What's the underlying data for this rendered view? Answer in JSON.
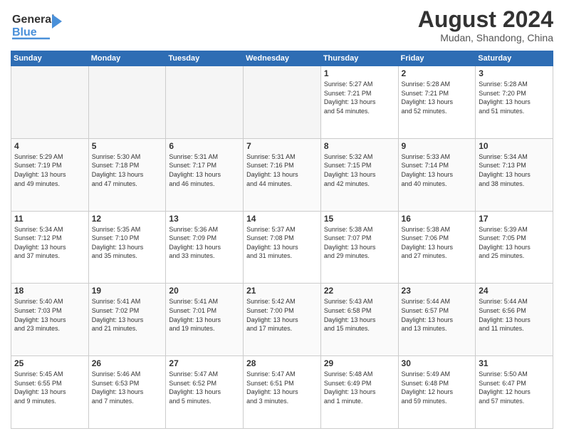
{
  "logo": {
    "line1": "General",
    "line2": "Blue"
  },
  "title": "August 2024",
  "subtitle": "Mudan, Shandong, China",
  "weekdays": [
    "Sunday",
    "Monday",
    "Tuesday",
    "Wednesday",
    "Thursday",
    "Friday",
    "Saturday"
  ],
  "weeks": [
    [
      {
        "day": "",
        "info": ""
      },
      {
        "day": "",
        "info": ""
      },
      {
        "day": "",
        "info": ""
      },
      {
        "day": "",
        "info": ""
      },
      {
        "day": "1",
        "info": "Sunrise: 5:27 AM\nSunset: 7:21 PM\nDaylight: 13 hours\nand 54 minutes."
      },
      {
        "day": "2",
        "info": "Sunrise: 5:28 AM\nSunset: 7:21 PM\nDaylight: 13 hours\nand 52 minutes."
      },
      {
        "day": "3",
        "info": "Sunrise: 5:28 AM\nSunset: 7:20 PM\nDaylight: 13 hours\nand 51 minutes."
      }
    ],
    [
      {
        "day": "4",
        "info": "Sunrise: 5:29 AM\nSunset: 7:19 PM\nDaylight: 13 hours\nand 49 minutes."
      },
      {
        "day": "5",
        "info": "Sunrise: 5:30 AM\nSunset: 7:18 PM\nDaylight: 13 hours\nand 47 minutes."
      },
      {
        "day": "6",
        "info": "Sunrise: 5:31 AM\nSunset: 7:17 PM\nDaylight: 13 hours\nand 46 minutes."
      },
      {
        "day": "7",
        "info": "Sunrise: 5:31 AM\nSunset: 7:16 PM\nDaylight: 13 hours\nand 44 minutes."
      },
      {
        "day": "8",
        "info": "Sunrise: 5:32 AM\nSunset: 7:15 PM\nDaylight: 13 hours\nand 42 minutes."
      },
      {
        "day": "9",
        "info": "Sunrise: 5:33 AM\nSunset: 7:14 PM\nDaylight: 13 hours\nand 40 minutes."
      },
      {
        "day": "10",
        "info": "Sunrise: 5:34 AM\nSunset: 7:13 PM\nDaylight: 13 hours\nand 38 minutes."
      }
    ],
    [
      {
        "day": "11",
        "info": "Sunrise: 5:34 AM\nSunset: 7:12 PM\nDaylight: 13 hours\nand 37 minutes."
      },
      {
        "day": "12",
        "info": "Sunrise: 5:35 AM\nSunset: 7:10 PM\nDaylight: 13 hours\nand 35 minutes."
      },
      {
        "day": "13",
        "info": "Sunrise: 5:36 AM\nSunset: 7:09 PM\nDaylight: 13 hours\nand 33 minutes."
      },
      {
        "day": "14",
        "info": "Sunrise: 5:37 AM\nSunset: 7:08 PM\nDaylight: 13 hours\nand 31 minutes."
      },
      {
        "day": "15",
        "info": "Sunrise: 5:38 AM\nSunset: 7:07 PM\nDaylight: 13 hours\nand 29 minutes."
      },
      {
        "day": "16",
        "info": "Sunrise: 5:38 AM\nSunset: 7:06 PM\nDaylight: 13 hours\nand 27 minutes."
      },
      {
        "day": "17",
        "info": "Sunrise: 5:39 AM\nSunset: 7:05 PM\nDaylight: 13 hours\nand 25 minutes."
      }
    ],
    [
      {
        "day": "18",
        "info": "Sunrise: 5:40 AM\nSunset: 7:03 PM\nDaylight: 13 hours\nand 23 minutes."
      },
      {
        "day": "19",
        "info": "Sunrise: 5:41 AM\nSunset: 7:02 PM\nDaylight: 13 hours\nand 21 minutes."
      },
      {
        "day": "20",
        "info": "Sunrise: 5:41 AM\nSunset: 7:01 PM\nDaylight: 13 hours\nand 19 minutes."
      },
      {
        "day": "21",
        "info": "Sunrise: 5:42 AM\nSunset: 7:00 PM\nDaylight: 13 hours\nand 17 minutes."
      },
      {
        "day": "22",
        "info": "Sunrise: 5:43 AM\nSunset: 6:58 PM\nDaylight: 13 hours\nand 15 minutes."
      },
      {
        "day": "23",
        "info": "Sunrise: 5:44 AM\nSunset: 6:57 PM\nDaylight: 13 hours\nand 13 minutes."
      },
      {
        "day": "24",
        "info": "Sunrise: 5:44 AM\nSunset: 6:56 PM\nDaylight: 13 hours\nand 11 minutes."
      }
    ],
    [
      {
        "day": "25",
        "info": "Sunrise: 5:45 AM\nSunset: 6:55 PM\nDaylight: 13 hours\nand 9 minutes."
      },
      {
        "day": "26",
        "info": "Sunrise: 5:46 AM\nSunset: 6:53 PM\nDaylight: 13 hours\nand 7 minutes."
      },
      {
        "day": "27",
        "info": "Sunrise: 5:47 AM\nSunset: 6:52 PM\nDaylight: 13 hours\nand 5 minutes."
      },
      {
        "day": "28",
        "info": "Sunrise: 5:47 AM\nSunset: 6:51 PM\nDaylight: 13 hours\nand 3 minutes."
      },
      {
        "day": "29",
        "info": "Sunrise: 5:48 AM\nSunset: 6:49 PM\nDaylight: 13 hours\nand 1 minute."
      },
      {
        "day": "30",
        "info": "Sunrise: 5:49 AM\nSunset: 6:48 PM\nDaylight: 12 hours\nand 59 minutes."
      },
      {
        "day": "31",
        "info": "Sunrise: 5:50 AM\nSunset: 6:47 PM\nDaylight: 12 hours\nand 57 minutes."
      }
    ]
  ]
}
